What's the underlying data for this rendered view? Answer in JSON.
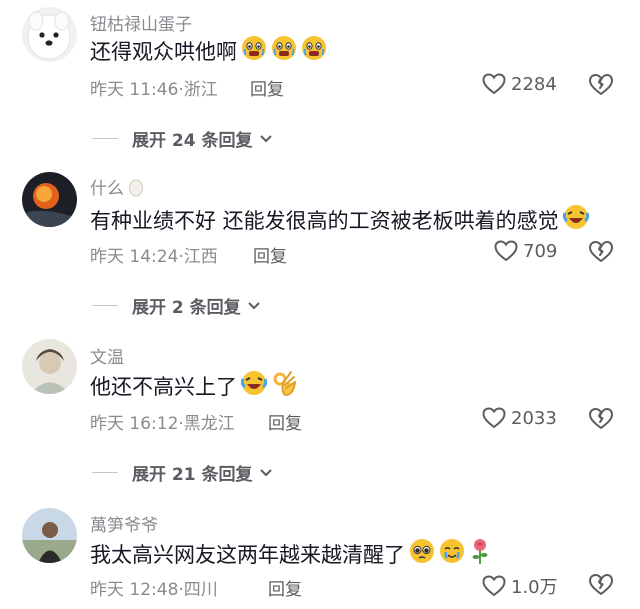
{
  "comments": [
    {
      "username": "钮枯禄山蛋子",
      "text": "还得观众哄他啊",
      "emojis": [
        "fearful-tear-emoji",
        "fearful-tear-emoji",
        "fearful-tear-emoji"
      ],
      "meta": "昨天 11:46·浙江",
      "reply_label": "回复",
      "likes": "2284",
      "expand_label": "展开 24 条回复"
    },
    {
      "username": "什么",
      "username_emoji": "egg-emoji",
      "text": "有种业绩不好 还能发很高的工资被老板哄着的感觉",
      "emojis": [
        "laughing-tears-emoji"
      ],
      "meta": "昨天 14:24·江西",
      "reply_label": "回复",
      "likes": "709",
      "expand_label": "展开 2 条回复"
    },
    {
      "username": "文温",
      "text": "他还不高兴上了",
      "emojis": [
        "laughing-tears-emoji",
        "ok-hand-emoji"
      ],
      "meta": "昨天 16:12·黑龙江",
      "reply_label": "回复",
      "likes": "2033",
      "expand_label": "展开 21 条回复"
    },
    {
      "username": "萬笋爷爷",
      "text": "我太高兴网友这两年越来越清醒了",
      "emojis": [
        "pleading-face-emoji",
        "crying-smile-emoji",
        "rose-emoji"
      ],
      "meta": "昨天 12:48·四川",
      "reply_label": "回复",
      "likes": "1.0万"
    }
  ],
  "colors": {
    "text": "#161823",
    "muted": "#8a8b91",
    "action": "#5b5c62",
    "emoji_yellow": "#f7c331"
  }
}
